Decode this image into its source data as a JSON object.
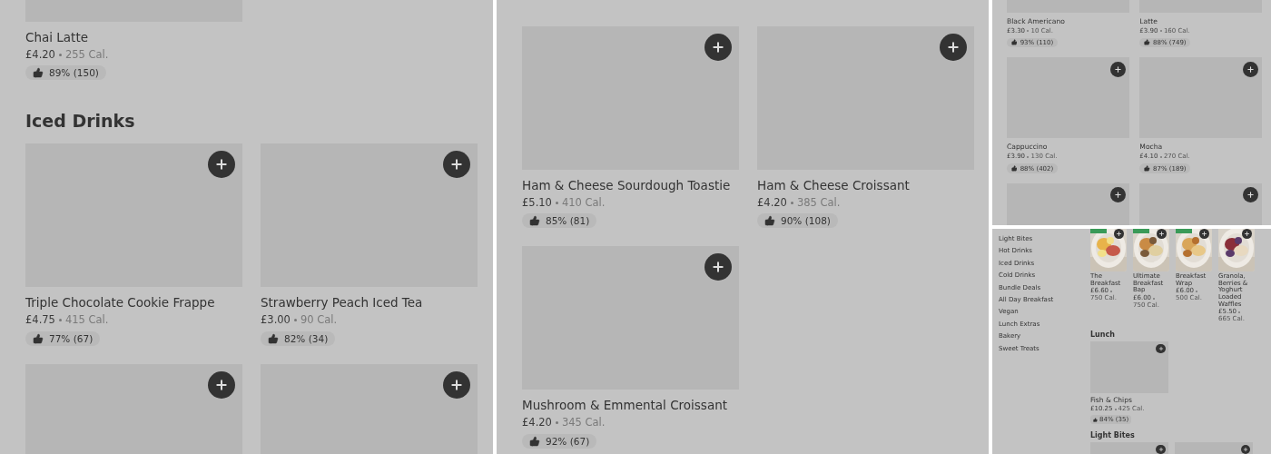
{
  "panels": [
    {
      "kind": "full",
      "blocks": [
        {
          "kind": "cards",
          "items": [
            {
              "name": "Chai Latte",
              "price": "£4.20",
              "calories": "255 Cal.",
              "rating": "89% (150)",
              "cut_top": true
            }
          ]
        },
        {
          "kind": "heading",
          "text": "Iced Drinks"
        },
        {
          "kind": "cards",
          "items": [
            {
              "name": "Triple Chocolate Cookie Frappe",
              "price": "£4.75",
              "calories": "415 Cal.",
              "rating": "77% (67)"
            },
            {
              "name": "Strawberry Peach Iced Tea",
              "price": "£3.00",
              "calories": "90 Cal.",
              "rating": "82% (34)"
            },
            {
              "add_button": true
            },
            {
              "add_button": true
            }
          ]
        }
      ]
    },
    {
      "kind": "full-offset",
      "blocks": [
        {
          "kind": "cards",
          "items": [
            {
              "name": "Ham & Cheese Sourdough Toastie",
              "price": "£5.10",
              "calories": "410 Cal.",
              "rating": "85% (81)"
            },
            {
              "name": "Ham & Cheese Croissant",
              "price": "£4.20",
              "calories": "385 Cal.",
              "rating": "90% (108)"
            },
            {
              "name": "Mushroom & Emmental Croissant",
              "price": "£4.20",
              "calories": "345 Cal.",
              "rating": "92% (67)"
            }
          ]
        }
      ]
    },
    {
      "kind": "compact",
      "blocks": [
        {
          "kind": "cards",
          "items": [
            {
              "name": "Black Americano",
              "price": "£3.30",
              "calories": "10 Cal.",
              "rating": "93% (110)",
              "cut_top": true
            },
            {
              "name": "Latte",
              "price": "£3.90",
              "calories": "160 Cal.",
              "rating": "88% (749)",
              "cut_top": true
            },
            {
              "name": "Cappuccino",
              "price": "£3.90",
              "calories": "130 Cal.",
              "rating": "88% (402)"
            },
            {
              "name": "Mocha",
              "price": "£4.10",
              "calories": "270 Cal.",
              "rating": "87% (189)"
            },
            {
              "add_button": true
            },
            {
              "add_button": true
            }
          ]
        }
      ]
    },
    {
      "kind": "mini",
      "sidebar": [
        "Light Bites",
        "Hot Drinks",
        "Iced Drinks",
        "Cold Drinks",
        "Bundle Deals",
        "All Day Breakfast",
        "Vegan",
        "Lunch Extras",
        "Bakery",
        "Sweet Treats"
      ],
      "blocks": [
        {
          "kind": "photos",
          "items": [
            {
              "name": "The Breakfast",
              "price": "£6.60",
              "calories": "750 Cal.",
              "offer": true
            },
            {
              "name": "Ultimate Breakfast Bap",
              "price": "£6.00",
              "calories": "750 Cal.",
              "offer": true
            },
            {
              "name": "Breakfast Wrap",
              "price": "£6.00",
              "calories": "500 Cal.",
              "offer": true
            },
            {
              "name": "Granola, Berries & Yoghurt Loaded Waffles",
              "price": "£5.50",
              "calories": "665 Cal.",
              "offer": false
            }
          ]
        },
        {
          "kind": "heading",
          "text": "Lunch"
        },
        {
          "kind": "cards",
          "items": [
            {
              "name": "Fish & Chips",
              "price": "£10.25",
              "calories": "425 Cal.",
              "rating": "84% (35)"
            }
          ]
        },
        {
          "kind": "heading",
          "text": "Light Bites"
        },
        {
          "kind": "cards",
          "items": [
            {
              "add_button": true
            },
            {
              "add_button": true
            }
          ]
        }
      ]
    }
  ]
}
